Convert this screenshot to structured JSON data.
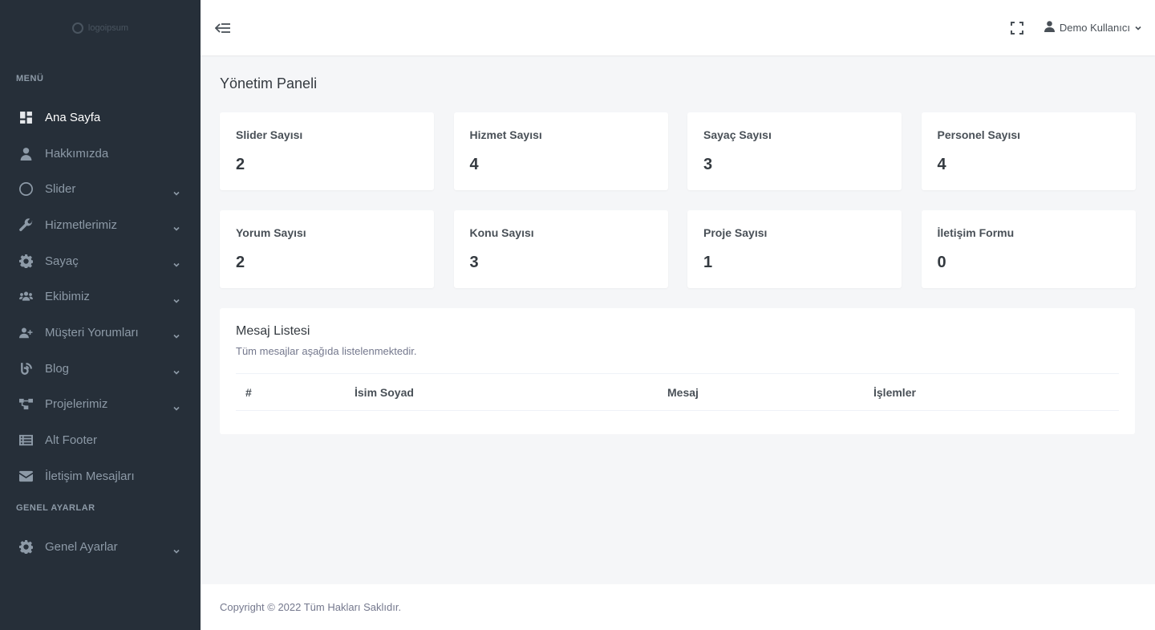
{
  "logo": {
    "text": "logoipsum"
  },
  "sidebar": {
    "section_menu": "MENÜ",
    "section_settings": "GENEL AYARLAR",
    "items": [
      {
        "label": "Ana Sayfa",
        "icon": "dashboard-icon",
        "active": true,
        "has_submenu": false
      },
      {
        "label": "Hakkımızda",
        "icon": "user-icon",
        "active": false,
        "has_submenu": false
      },
      {
        "label": "Slider",
        "icon": "circle-icon",
        "active": false,
        "has_submenu": true
      },
      {
        "label": "Hizmetlerimiz",
        "icon": "wrench-icon",
        "active": false,
        "has_submenu": true
      },
      {
        "label": "Sayaç",
        "icon": "gear-icon",
        "active": false,
        "has_submenu": true
      },
      {
        "label": "Ekibimiz",
        "icon": "users-icon",
        "active": false,
        "has_submenu": true
      },
      {
        "label": "Müşteri Yorumları",
        "icon": "user-plus-icon",
        "active": false,
        "has_submenu": true
      },
      {
        "label": "Blog",
        "icon": "blog-icon",
        "active": false,
        "has_submenu": true
      },
      {
        "label": "Projelerimiz",
        "icon": "sitemap-icon",
        "active": false,
        "has_submenu": true
      },
      {
        "label": "Alt Footer",
        "icon": "list-icon",
        "active": false,
        "has_submenu": false
      },
      {
        "label": "İletişim Mesajları",
        "icon": "envelope-icon",
        "active": false,
        "has_submenu": false
      }
    ],
    "settings_items": [
      {
        "label": "Genel Ayarlar",
        "icon": "gear-icon",
        "active": false,
        "has_submenu": true
      }
    ]
  },
  "topbar": {
    "user_name": "Demo Kullanıcı"
  },
  "page": {
    "title": "Yönetim Paneli"
  },
  "stats": [
    {
      "label": "Slider Sayısı",
      "value": "2"
    },
    {
      "label": "Hizmet Sayısı",
      "value": "4"
    },
    {
      "label": "Sayaç Sayısı",
      "value": "3"
    },
    {
      "label": "Personel Sayısı",
      "value": "4"
    },
    {
      "label": "Yorum Sayısı",
      "value": "2"
    },
    {
      "label": "Konu Sayısı",
      "value": "3"
    },
    {
      "label": "Proje Sayısı",
      "value": "1"
    },
    {
      "label": "İletişim Formu",
      "value": "0"
    }
  ],
  "messages": {
    "title": "Mesaj Listesi",
    "subtitle": "Tüm mesajlar aşağıda listelenmektedir.",
    "columns": [
      "#",
      "İsim Soyad",
      "Mesaj",
      "İşlemler"
    ],
    "rows": []
  },
  "footer": {
    "text": "Copyright © 2022 Tüm Hakları Saklıdır."
  },
  "colors": {
    "sidebar_bg": "#262f39",
    "sidebar_text": "#8d9aa7",
    "active_text": "#ffffff",
    "content_bg": "#f5f6f8"
  }
}
